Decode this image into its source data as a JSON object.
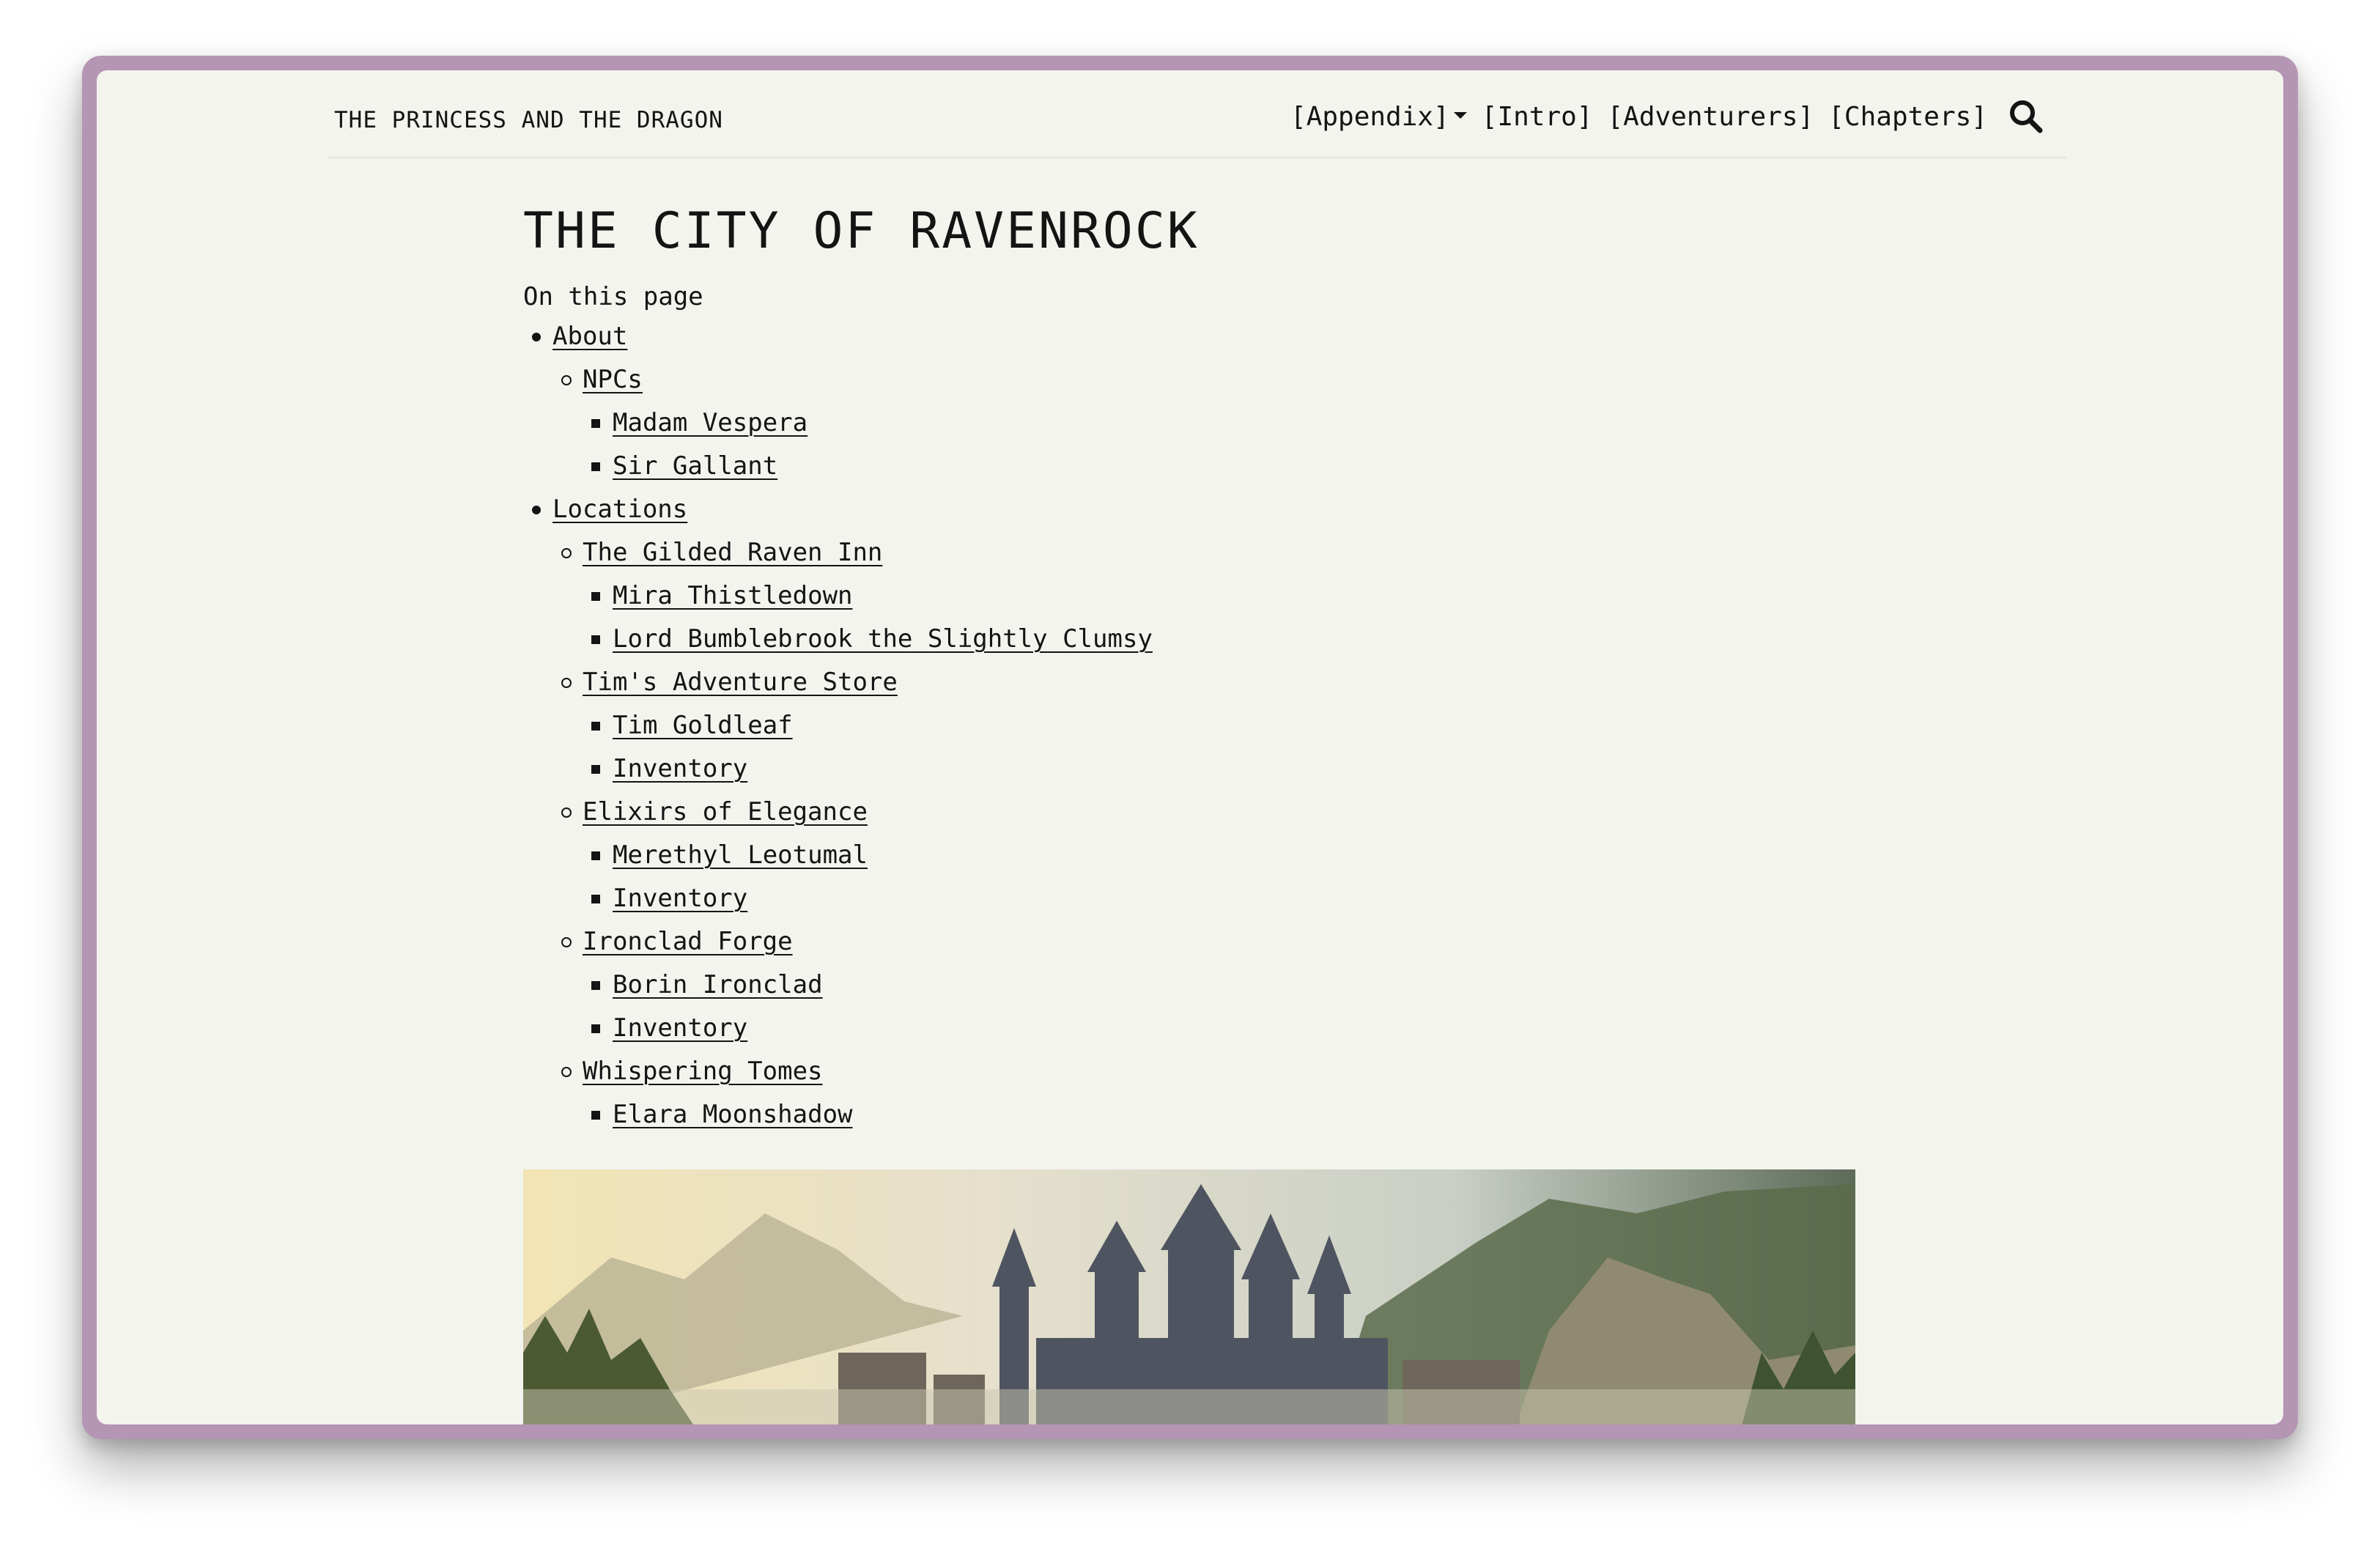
{
  "site": {
    "brand": "THE PRINCESS AND THE DRAGON"
  },
  "nav": {
    "items": [
      {
        "label": "[Appendix]",
        "dropdown": true
      },
      {
        "label": "[Intro]"
      },
      {
        "label": "[Adventurers]"
      },
      {
        "label": "[Chapters]"
      }
    ],
    "search_icon": "search-icon"
  },
  "page": {
    "title": "THE CITY OF RAVENROCK",
    "toc_title": "On this page"
  },
  "toc": [
    {
      "level": 1,
      "label": "About"
    },
    {
      "level": 2,
      "label": "NPCs"
    },
    {
      "level": 3,
      "label": "Madam Vespera"
    },
    {
      "level": 3,
      "label": "Sir Gallant"
    },
    {
      "level": 1,
      "label": "Locations"
    },
    {
      "level": 2,
      "label": "The Gilded Raven Inn"
    },
    {
      "level": 3,
      "label": "Mira Thistledown"
    },
    {
      "level": 3,
      "label": "Lord Bumblebrook the Slightly Clumsy"
    },
    {
      "level": 2,
      "label": "Tim's Adventure Store"
    },
    {
      "level": 3,
      "label": "Tim Goldleaf"
    },
    {
      "level": 3,
      "label": "Inventory"
    },
    {
      "level": 2,
      "label": "Elixirs of Elegance"
    },
    {
      "level": 3,
      "label": "Merethyl Leotumal"
    },
    {
      "level": 3,
      "label": "Inventory"
    },
    {
      "level": 2,
      "label": "Ironclad Forge"
    },
    {
      "level": 3,
      "label": "Borin Ironclad"
    },
    {
      "level": 3,
      "label": "Inventory"
    },
    {
      "level": 2,
      "label": "Whispering Tomes"
    },
    {
      "level": 3,
      "label": "Elara Moonshadow"
    }
  ],
  "colors": {
    "window_frame": "#b496b4",
    "page_background": "#f3f4ee",
    "text": "#141414"
  }
}
